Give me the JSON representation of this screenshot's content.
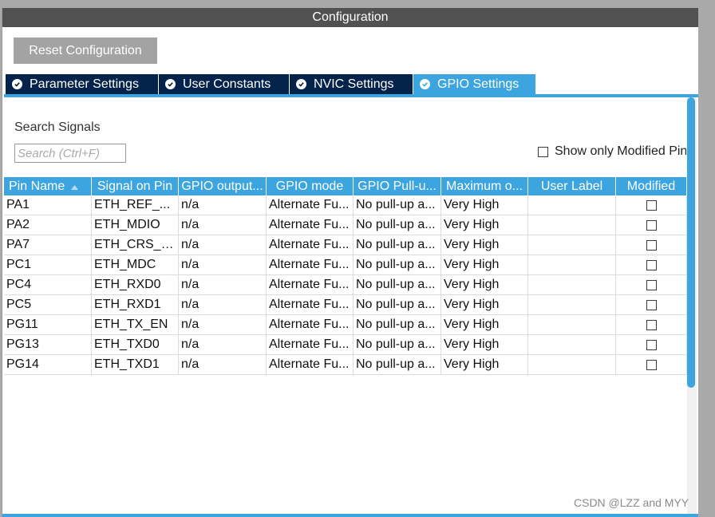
{
  "window": {
    "title": "Configuration"
  },
  "toolbar": {
    "reset_label": "Reset Configuration"
  },
  "tabs": [
    {
      "label": "Parameter Settings",
      "active": false
    },
    {
      "label": "User Constants",
      "active": false
    },
    {
      "label": "NVIC Settings",
      "active": false
    },
    {
      "label": "GPIO Settings",
      "active": true
    }
  ],
  "search": {
    "label": "Search Signals",
    "placeholder": "Search (Ctrl+F)",
    "value": ""
  },
  "filter": {
    "show_modified_label": "Show only Modified Pins",
    "checked": false
  },
  "table": {
    "columns": [
      "Pin Name",
      "Signal on Pin",
      "GPIO output...",
      "GPIO mode",
      "GPIO Pull-u...",
      "Maximum o...",
      "User Label",
      "Modified"
    ],
    "sort": {
      "column": "Pin Name",
      "direction": "ascending"
    },
    "rows": [
      {
        "pin": "PA1",
        "signal": "ETH_REF_...",
        "output": "n/a",
        "mode": "Alternate Fu...",
        "pull": "No pull-up a...",
        "speed": "Very High",
        "label": "",
        "modified": false
      },
      {
        "pin": "PA2",
        "signal": "ETH_MDIO",
        "output": "n/a",
        "mode": "Alternate Fu...",
        "pull": "No pull-up a...",
        "speed": "Very High",
        "label": "",
        "modified": false
      },
      {
        "pin": "PA7",
        "signal": "ETH_CRS_DV",
        "output": "n/a",
        "mode": "Alternate Fu...",
        "pull": "No pull-up a...",
        "speed": "Very High",
        "label": "",
        "modified": false
      },
      {
        "pin": "PC1",
        "signal": "ETH_MDC",
        "output": "n/a",
        "mode": "Alternate Fu...",
        "pull": "No pull-up a...",
        "speed": "Very High",
        "label": "",
        "modified": false
      },
      {
        "pin": "PC4",
        "signal": "ETH_RXD0",
        "output": "n/a",
        "mode": "Alternate Fu...",
        "pull": "No pull-up a...",
        "speed": "Very High",
        "label": "",
        "modified": false
      },
      {
        "pin": "PC5",
        "signal": "ETH_RXD1",
        "output": "n/a",
        "mode": "Alternate Fu...",
        "pull": "No pull-up a...",
        "speed": "Very High",
        "label": "",
        "modified": false
      },
      {
        "pin": "PG11",
        "signal": "ETH_TX_EN",
        "output": "n/a",
        "mode": "Alternate Fu...",
        "pull": "No pull-up a...",
        "speed": "Very High",
        "label": "",
        "modified": false
      },
      {
        "pin": "PG13",
        "signal": "ETH_TXD0",
        "output": "n/a",
        "mode": "Alternate Fu...",
        "pull": "No pull-up a...",
        "speed": "Very High",
        "label": "",
        "modified": false
      },
      {
        "pin": "PG14",
        "signal": "ETH_TXD1",
        "output": "n/a",
        "mode": "Alternate Fu...",
        "pull": "No pull-up a...",
        "speed": "Very High",
        "label": "",
        "modified": false
      }
    ]
  },
  "watermark": "CSDN @LZZ and MYY",
  "colors": {
    "accent": "#3ca5e0",
    "tab_dark": "#03234b",
    "titlebar": "#515151",
    "button": "#a3a3a3"
  },
  "icons": {
    "tab": "check-circle-icon",
    "sort": "sort-ascending-icon"
  }
}
